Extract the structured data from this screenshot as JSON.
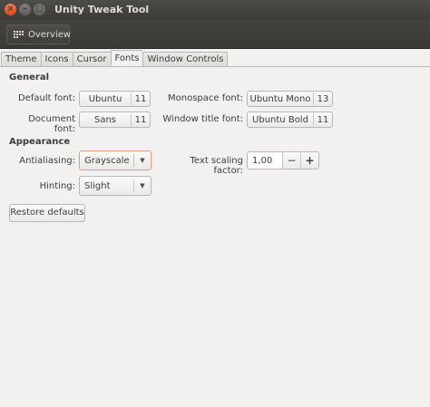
{
  "window": {
    "title": "Unity Tweak Tool",
    "close_glyph": "×",
    "minimize_glyph": "–",
    "maximize_glyph": "□"
  },
  "toolbar": {
    "overview_label": "Overview",
    "overview_icon": "grid-icon"
  },
  "tabs": [
    {
      "label": "Theme",
      "active": false
    },
    {
      "label": "Icons",
      "active": false
    },
    {
      "label": "Cursor",
      "active": false
    },
    {
      "label": "Fonts",
      "active": true
    },
    {
      "label": "Window Controls",
      "active": false
    }
  ],
  "general": {
    "heading": "General",
    "default_font": {
      "label": "Default font:",
      "name": "Ubuntu",
      "size": "11"
    },
    "document_font": {
      "label": "Document font:",
      "name": "Sans",
      "size": "11"
    },
    "monospace_font": {
      "label": "Monospace font:",
      "name": "Ubuntu Mono",
      "size": "13"
    },
    "window_title_font": {
      "label": "Window title font:",
      "name": "Ubuntu Bold",
      "size": "11"
    }
  },
  "appearance": {
    "heading": "Appearance",
    "antialiasing": {
      "label": "Antialiasing:",
      "value": "Grayscale"
    },
    "hinting": {
      "label": "Hinting:",
      "value": "Slight"
    },
    "text_scaling": {
      "label": "Text scaling factor:",
      "value": "1,00",
      "minus": "−",
      "plus": "+"
    }
  },
  "actions": {
    "restore_label": "Restore defaults"
  },
  "colors": {
    "titlebar": "#3c3b37",
    "background": "#f2f1f0",
    "close_button": "#df4a16",
    "focus_border": "#e59a7e"
  }
}
